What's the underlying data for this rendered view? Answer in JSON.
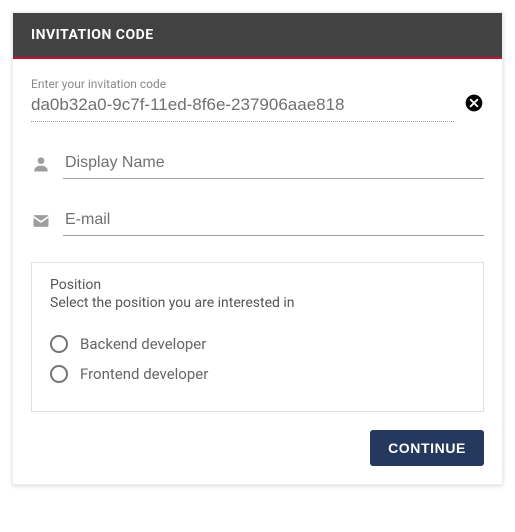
{
  "header": {
    "title": "INVITATION CODE"
  },
  "code": {
    "label": "Enter your invitation code",
    "value": "da0b32a0-9c7f-11ed-8f6e-237906aae818"
  },
  "display_name": {
    "placeholder": "Display Name"
  },
  "email": {
    "placeholder": "E-mail"
  },
  "position": {
    "title": "Position",
    "subtitle": "Select the position you are interested in",
    "options": [
      "Backend developer",
      "Frontend developer"
    ]
  },
  "buttons": {
    "continue": "CONTINUE"
  }
}
